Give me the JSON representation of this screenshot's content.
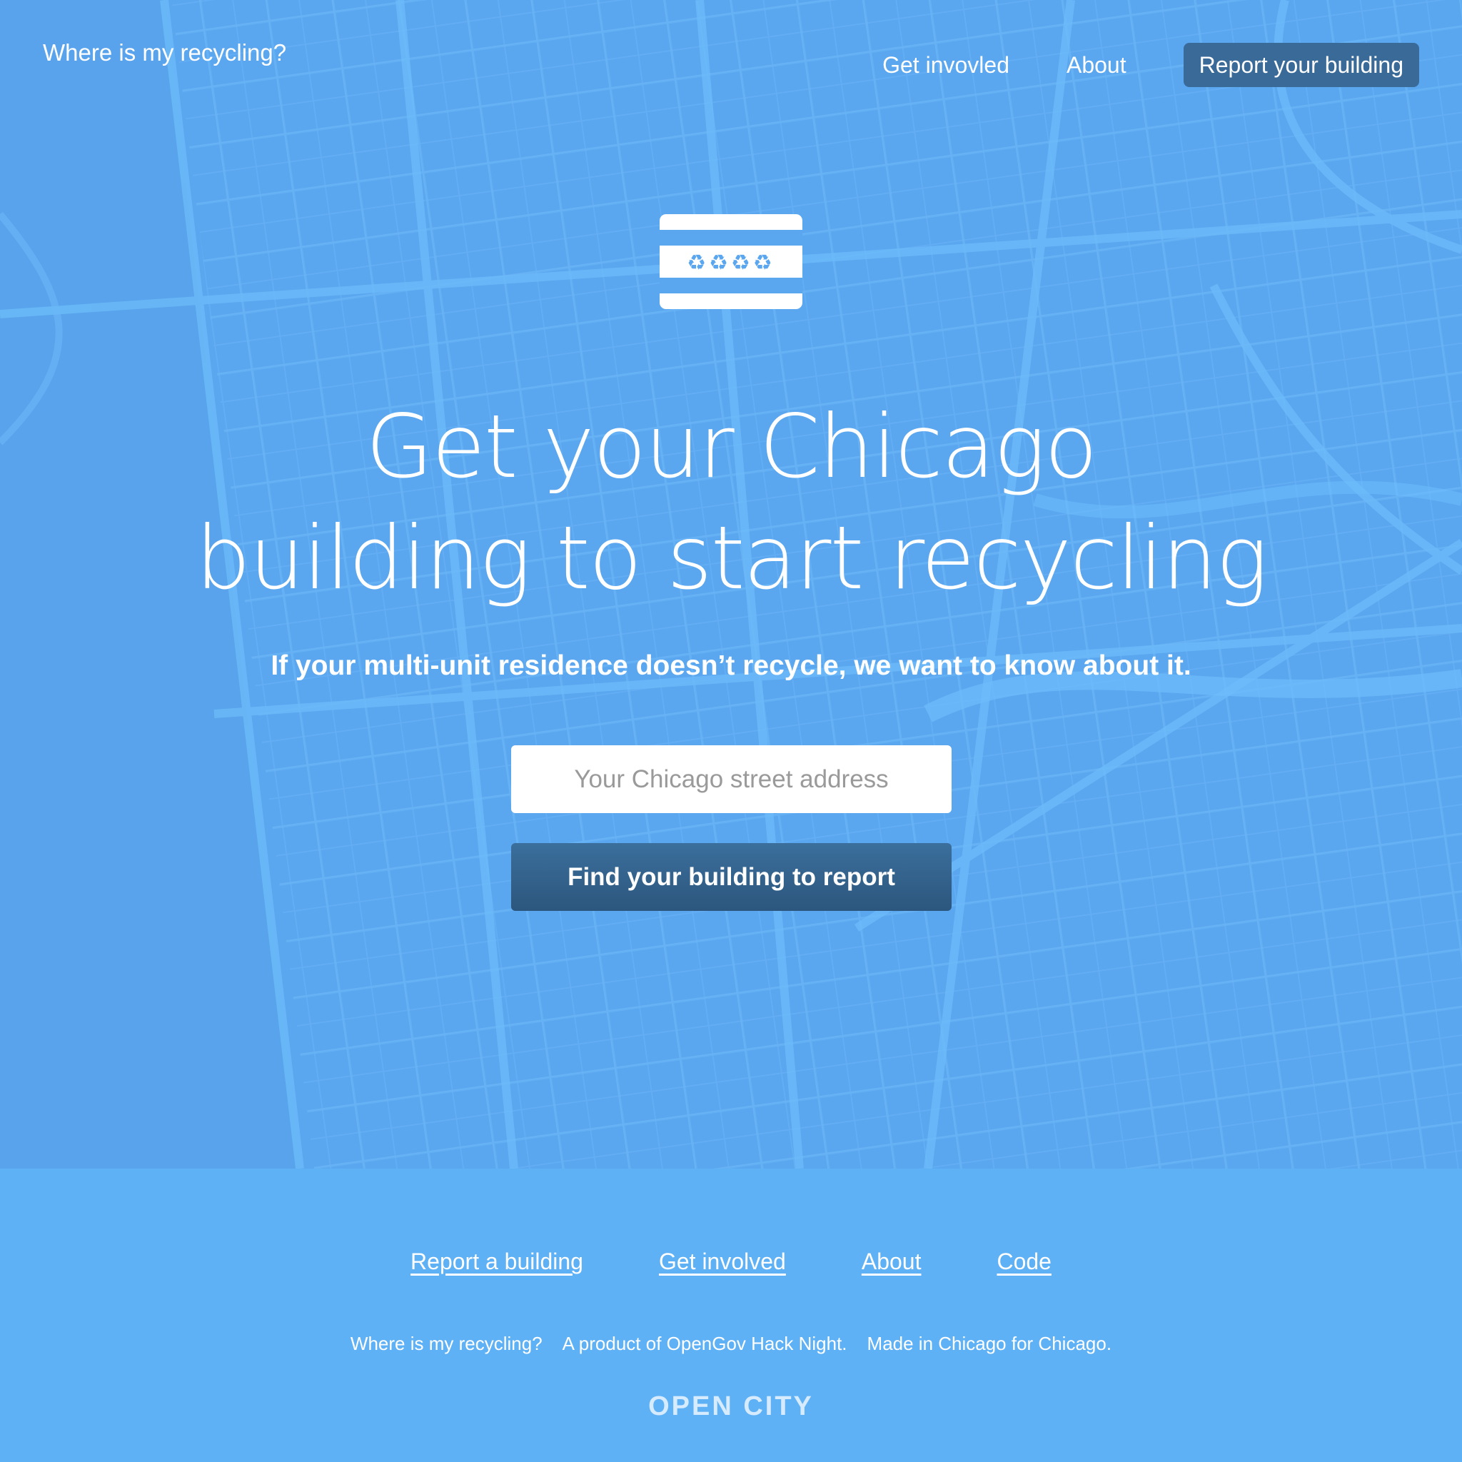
{
  "header": {
    "brand": "Where is my recycling?",
    "nav": {
      "get_involved": "Get invovled",
      "about": "About",
      "report": "Report your building"
    }
  },
  "hero": {
    "logo_icon": "recycling-flag-icon",
    "logo_symbols": "♻♻♻♻",
    "headline_line1": "Get your Chicago",
    "headline_line2": "building to start recycling",
    "subhead": "If your multi-unit residence doesn’t recycle, we want to know about it.",
    "address_placeholder": "Your Chicago street address",
    "address_value": "",
    "find_button": "Find your building to report"
  },
  "footer": {
    "links": {
      "report": "Report a building",
      "get_involved": "Get involved",
      "about": "About",
      "code": "Code"
    },
    "tagline": {
      "name": "Where is my recycling?",
      "product": "A product of OpenGov Hack Night.",
      "made": "Made in Chicago for Chicago."
    },
    "org": "OPEN CITY"
  },
  "colors": {
    "hero_bg": "#5aa6ef",
    "footer_bg": "#5fb1f6",
    "button_dark": "#2c567d",
    "nav_cta": "#3a6b98",
    "map_lines": "#6bb8f8"
  }
}
